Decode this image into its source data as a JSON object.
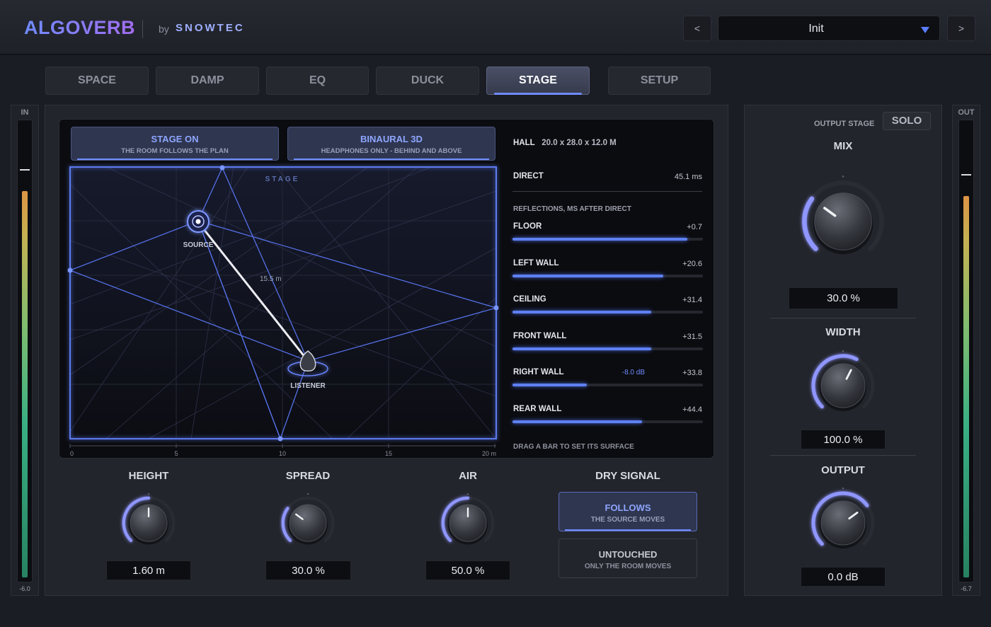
{
  "header": {
    "logo": "ALGOVERB",
    "by": "by",
    "company": "SNOWTEC",
    "prev_label": "<",
    "next_label": ">",
    "preset_name": "Init"
  },
  "tabs": [
    {
      "label": "SPACE",
      "active": false
    },
    {
      "label": "DAMP",
      "active": false
    },
    {
      "label": "EQ",
      "active": false
    },
    {
      "label": "DUCK",
      "active": false
    },
    {
      "label": "STAGE",
      "active": true
    },
    {
      "label": "SETUP",
      "active": false
    }
  ],
  "meters": {
    "in": {
      "label": "IN",
      "value": "-6.0",
      "level": 0.85,
      "peak": 0.895
    },
    "out": {
      "label": "OUT",
      "value": "-6.7",
      "level": 0.84,
      "peak": 0.885
    }
  },
  "stage": {
    "toggle_on": {
      "title": "STAGE ON",
      "subtitle": "THE ROOM FOLLOWS THE PLAN"
    },
    "toggle_binaural": {
      "title": "BINAURAL 3D",
      "subtitle": "HEADPHONES ONLY - BEHIND AND ABOVE"
    },
    "plan_label": "STAGE",
    "source_label": "SOURCE",
    "listener_label": "LISTENER",
    "distance_label": "15.5 m",
    "axis_ticks": [
      "0",
      "5",
      "10",
      "15",
      "20 m"
    ],
    "source_pos_m": [
      6,
      5.5
    ],
    "listener_pos_m": [
      11.2,
      18.3
    ]
  },
  "room": {
    "hall_label": "HALL",
    "hall_dims": "20.0 x 28.0 x 12.0 M",
    "direct_label": "DIRECT",
    "direct_value": "45.1 ms",
    "reflections_header": "REFLECTIONS, MS AFTER DIRECT",
    "reflections": [
      {
        "label": "FLOOR",
        "value": "+0.7",
        "level": 0.92,
        "note": ""
      },
      {
        "label": "LEFT WALL",
        "value": "+20.6",
        "level": 0.79,
        "note": ""
      },
      {
        "label": "CEILING",
        "value": "+31.4",
        "level": 0.73,
        "note": ""
      },
      {
        "label": "FRONT WALL",
        "value": "+31.5",
        "level": 0.73,
        "note": ""
      },
      {
        "label": "RIGHT WALL",
        "value": "+33.8",
        "level": 0.39,
        "note": "-8.0 dB"
      },
      {
        "label": "REAR WALL",
        "value": "+44.4",
        "level": 0.68,
        "note": ""
      }
    ],
    "hint": "DRAG A BAR TO SET ITS SURFACE"
  },
  "controls": {
    "height": {
      "label": "HEIGHT",
      "value": "1.60 m",
      "level": 0.5
    },
    "spread": {
      "label": "SPREAD",
      "value": "30.0 %",
      "level": 0.3
    },
    "air": {
      "label": "AIR",
      "value": "50.0 %",
      "level": 0.5
    }
  },
  "dry_signal": {
    "title": "DRY SIGNAL",
    "follows": {
      "title": "FOLLOWS",
      "subtitle": "THE SOURCE MOVES"
    },
    "untouched": {
      "title": "UNTOUCHED",
      "subtitle": "ONLY THE ROOM MOVES"
    }
  },
  "output_stage": {
    "title": "OUTPUT STAGE",
    "solo_label": "SOLO",
    "mix": {
      "label": "MIX",
      "value": "30.0 %",
      "level": 0.3
    },
    "width": {
      "label": "WIDTH",
      "value": "100.0 %",
      "level": 0.6
    },
    "output": {
      "label": "OUTPUT",
      "value": "0.0 dB",
      "level": 0.7
    }
  },
  "colors": {
    "accent": "#6f8cff",
    "accent_purple": "#a26df0",
    "background": "#1b1d24",
    "stage_line": "#4f6ae0"
  }
}
